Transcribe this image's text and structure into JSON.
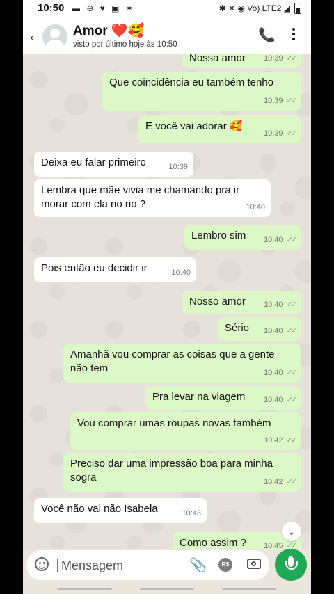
{
  "status_bar": {
    "time": "10:50",
    "left_icons": "▬ ⊖ ♥ ▣ ✶",
    "right_icons": "✱ ✕ ◉ Vo) LTE2 ◢"
  },
  "header": {
    "back_icon": "arrow-left-icon",
    "contact_name": "Amor ❤️🥰",
    "last_seen": "visto por último hoje às 10:50"
  },
  "messages": [
    {
      "dir": "out",
      "text": "Nossa amor",
      "time": "10:39",
      "ticks": "✓✓"
    },
    {
      "dir": "out",
      "text": "Que coincidência eu também tenho",
      "time": "10:39",
      "ticks": "✓✓"
    },
    {
      "dir": "out",
      "text": "E você vai adorar 🥰",
      "time": "10:39",
      "ticks": "✓✓"
    },
    {
      "dir": "in",
      "text": "Deixa eu falar primeiro",
      "time": "10:39"
    },
    {
      "dir": "in",
      "text": "Lembra que mãe vivia me chamando pra ir morar com ela no rio ?",
      "time": "10:40"
    },
    {
      "dir": "out",
      "text": "Lembro sim",
      "time": "10:40",
      "ticks": "✓✓"
    },
    {
      "dir": "in",
      "text": "Pois então eu decidir ir",
      "time": "10:40"
    },
    {
      "dir": "out",
      "text": "Nosso amor",
      "time": "10:40",
      "ticks": "✓✓"
    },
    {
      "dir": "out",
      "text": "Sério",
      "time": "10:40",
      "ticks": "✓✓"
    },
    {
      "dir": "out",
      "text": "Amanhã vou comprar as coisas que a gente não tem",
      "time": "10:40",
      "ticks": "✓✓"
    },
    {
      "dir": "out",
      "text": "Pra levar na viagem",
      "time": "10:40",
      "ticks": "✓✓"
    },
    {
      "dir": "out",
      "text": "Vou comprar umas roupas novas também",
      "time": "10:42",
      "ticks": "✓✓"
    },
    {
      "dir": "out",
      "text": "Preciso dar uma impressão boa para minha sogra",
      "time": "10:42",
      "ticks": "✓✓"
    },
    {
      "dir": "in",
      "text": "Você não vai não Isabela",
      "time": "10:43"
    },
    {
      "dir": "out",
      "text": "Como assim ?",
      "time": "10:45",
      "ticks": "✓✓"
    }
  ],
  "input": {
    "placeholder": "Mensagem",
    "rs_label": "RS"
  },
  "colors": {
    "outgoing_bubble": "#dcf8c6",
    "incoming_bubble": "#ffffff",
    "mic_button": "#1fa855"
  }
}
